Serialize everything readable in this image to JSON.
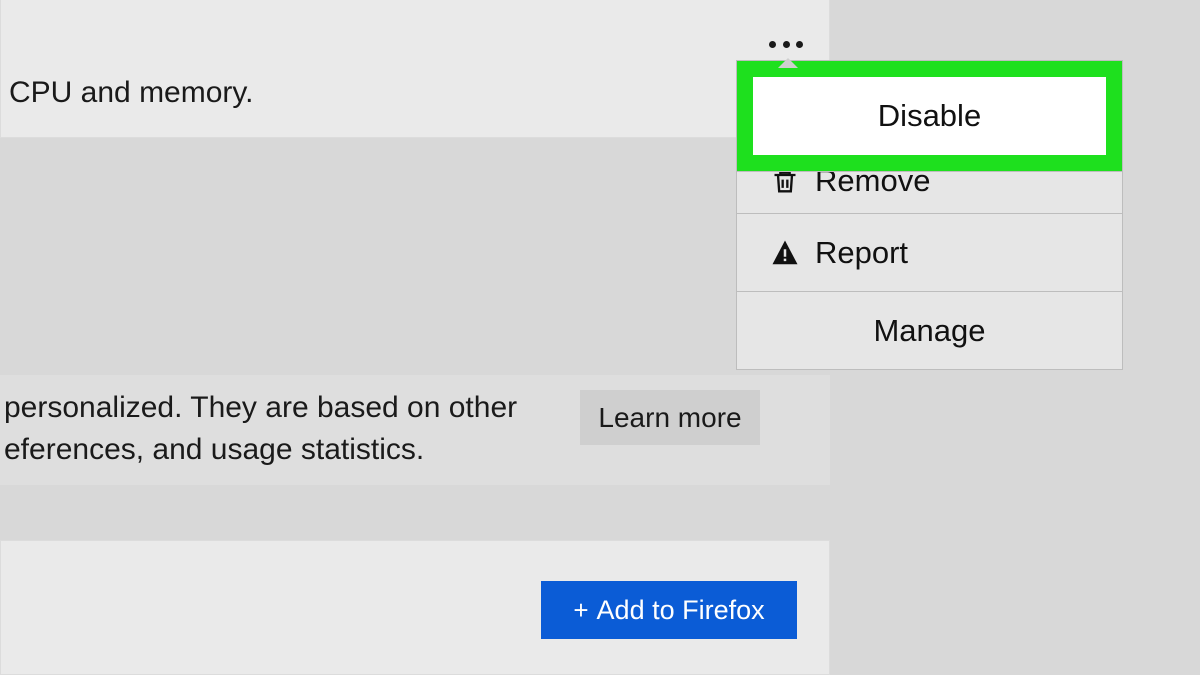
{
  "card_top": {
    "text": "CPU and memory."
  },
  "card_mid": {
    "text": "personalized. They are based on other eferences, and usage statistics.",
    "learn_more": "Learn more"
  },
  "card_bottom": {
    "add_button": "Add to Firefox"
  },
  "menu": {
    "disable": "Disable",
    "remove": "Remove",
    "report": "Report",
    "manage": "Manage"
  }
}
